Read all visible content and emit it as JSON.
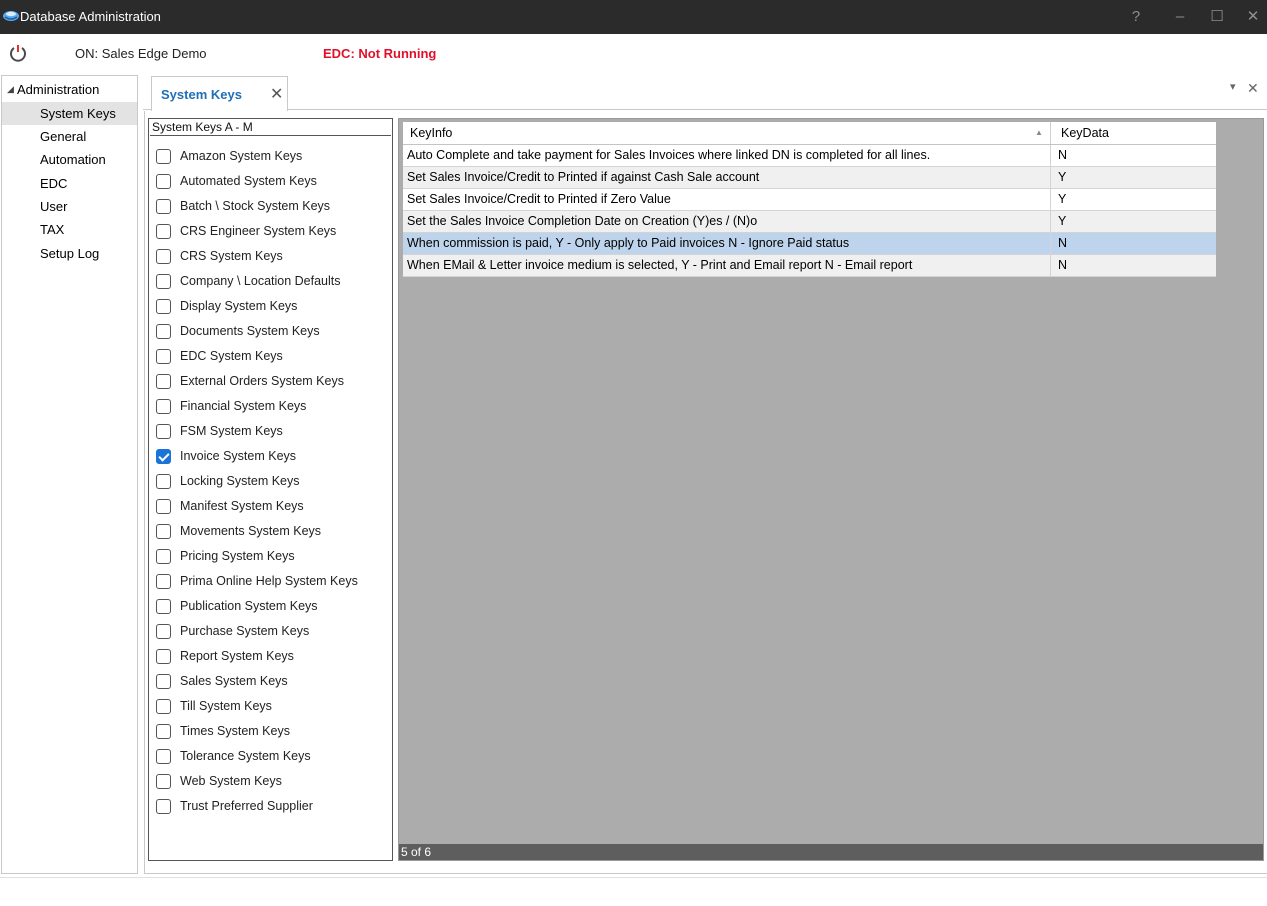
{
  "window": {
    "title": "Database Administration",
    "controls": [
      "?",
      "–",
      "☐",
      "✕"
    ]
  },
  "status": {
    "connection": "ON: Sales Edge Demo",
    "edc": "EDC: Not Running"
  },
  "tree": {
    "root": "Administration",
    "items": [
      "System Keys",
      "General",
      "Automation",
      "EDC",
      "User",
      "TAX",
      "Setup Log"
    ],
    "selected": "System Keys"
  },
  "tab": {
    "label": "System Keys",
    "close": "✕",
    "strip_controls": [
      "▾",
      "✕"
    ]
  },
  "checklist": {
    "header": "System Keys A - M",
    "items": [
      {
        "label": "Amazon System Keys",
        "checked": false
      },
      {
        "label": "Automated System Keys",
        "checked": false
      },
      {
        "label": "Batch \\ Stock System Keys",
        "checked": false
      },
      {
        "label": "CRS Engineer System Keys",
        "checked": false
      },
      {
        "label": "CRS System Keys",
        "checked": false
      },
      {
        "label": "Company \\ Location Defaults",
        "checked": false
      },
      {
        "label": "Display System Keys",
        "checked": false
      },
      {
        "label": "Documents System Keys",
        "checked": false
      },
      {
        "label": "EDC System Keys",
        "checked": false
      },
      {
        "label": "External Orders System Keys",
        "checked": false
      },
      {
        "label": "Financial System Keys",
        "checked": false
      },
      {
        "label": "FSM System Keys",
        "checked": false
      },
      {
        "label": "Invoice System Keys",
        "checked": true
      },
      {
        "label": "Locking System Keys",
        "checked": false
      },
      {
        "label": "Manifest System Keys",
        "checked": false
      },
      {
        "label": "Movements System Keys",
        "checked": false
      },
      {
        "label": "Pricing System Keys",
        "checked": false
      },
      {
        "label": "Prima Online Help System Keys",
        "checked": false
      },
      {
        "label": "Publication System Keys",
        "checked": false
      },
      {
        "label": "Purchase System Keys",
        "checked": false
      },
      {
        "label": "Report System Keys",
        "checked": false
      },
      {
        "label": "Sales System Keys",
        "checked": false
      },
      {
        "label": "Till System Keys",
        "checked": false
      },
      {
        "label": "Times System Keys",
        "checked": false
      },
      {
        "label": "Tolerance System Keys",
        "checked": false
      },
      {
        "label": "Web System Keys",
        "checked": false
      },
      {
        "label": "Trust Preferred Supplier",
        "checked": false
      }
    ]
  },
  "grid": {
    "columns": [
      "KeyInfo",
      "KeyData"
    ],
    "rows": [
      {
        "info": "Auto Complete and take payment for Sales Invoices where linked DN is completed for all lines.",
        "data": "N"
      },
      {
        "info": "Set Sales Invoice/Credit to Printed if against Cash Sale account",
        "data": "Y"
      },
      {
        "info": "Set Sales Invoice/Credit to Printed if Zero Value",
        "data": "Y"
      },
      {
        "info": "Set the Sales Invoice Completion Date on Creation (Y)es / (N)o",
        "data": "Y"
      },
      {
        "info": "When commission is paid, Y - Only apply to Paid invoices N - Ignore Paid status",
        "data": "N"
      },
      {
        "info": "When EMail & Letter invoice medium is selected, Y - Print and Email report N - Email report",
        "data": "N"
      }
    ],
    "selected_row": 4,
    "footer": "5 of 6"
  }
}
